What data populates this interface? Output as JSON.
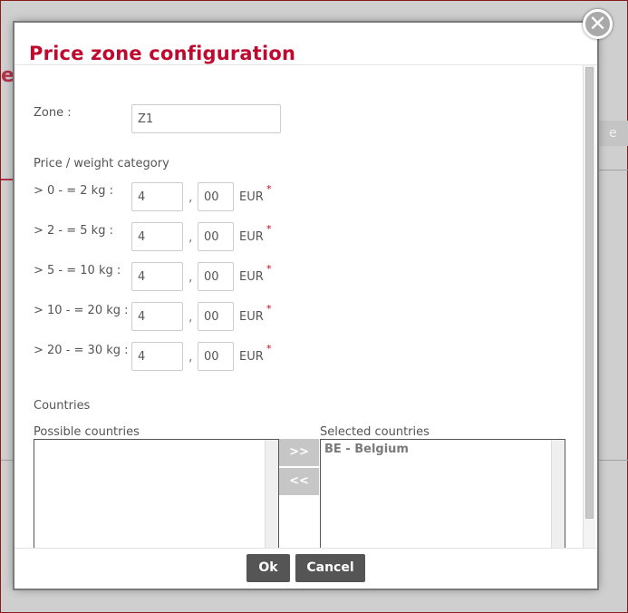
{
  "background": {
    "letter": "e",
    "button_fragment": "e"
  },
  "dialog": {
    "title": "Price zone configuration",
    "close_label": "✕",
    "zone_label": "Zone :",
    "zone_value": "Z1",
    "price_section_label": "Price / weight category",
    "currency": "EUR",
    "required_mark": "*",
    "decimal_separator": ",",
    "categories": [
      {
        "label": "> 0 - = 2 kg :",
        "units": "4",
        "cents": "00"
      },
      {
        "label": "> 2 - = 5 kg :",
        "units": "4",
        "cents": "00"
      },
      {
        "label": "> 5 - = 10 kg :",
        "units": "4",
        "cents": "00"
      },
      {
        "label": "> 10 - = 20 kg :",
        "units": "4",
        "cents": "00"
      },
      {
        "label": "> 20 - = 30 kg :",
        "units": "4",
        "cents": "00"
      }
    ],
    "countries_label": "Countries",
    "possible_countries_label": "Possible countries",
    "selected_countries_label": "Selected countries",
    "possible_countries": [],
    "selected_countries": [
      "BE - Belgium"
    ],
    "add_label": ">>",
    "remove_label": "<<",
    "ok_label": "Ok",
    "cancel_label": "Cancel"
  },
  "colors": {
    "title": "#c0092f",
    "button": "#555555",
    "required": "#d0021b"
  }
}
